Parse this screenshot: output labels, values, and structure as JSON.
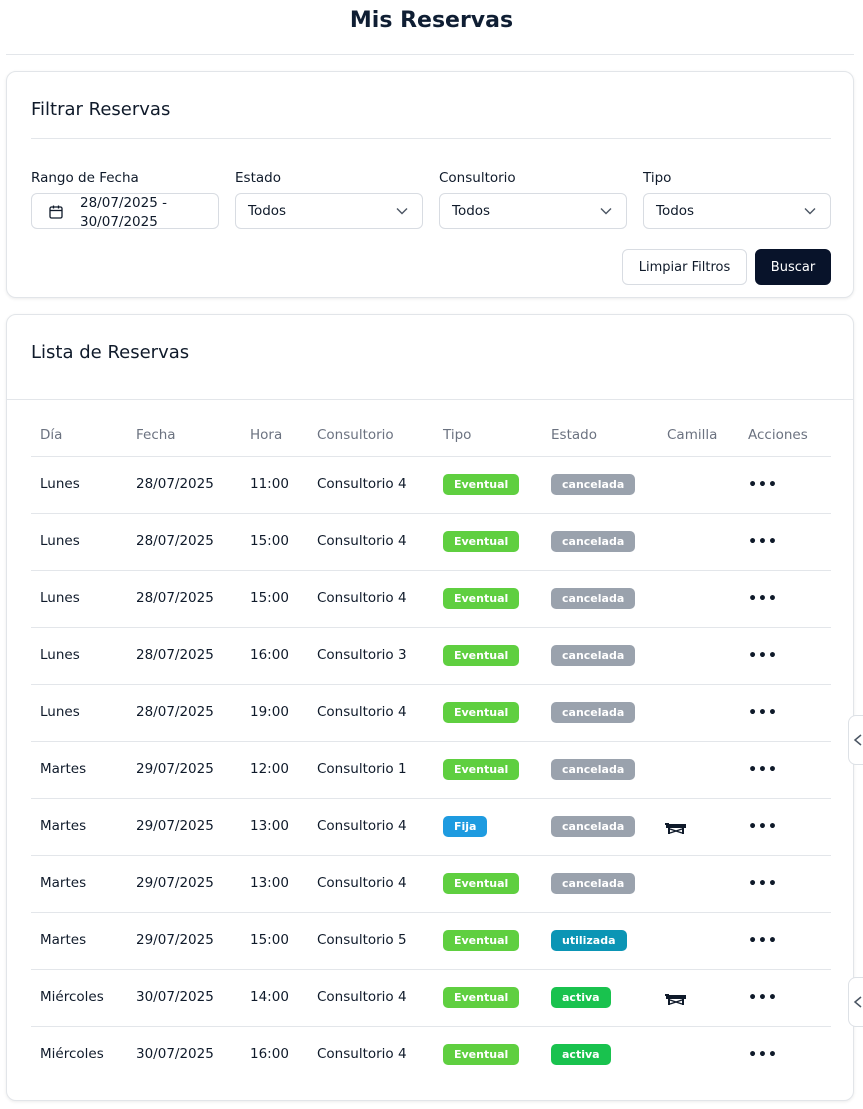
{
  "page": {
    "title": "Mis Reservas"
  },
  "filters": {
    "title": "Filtrar Reservas",
    "date_range": {
      "label": "Rango de Fecha",
      "value": "28/07/2025 - 30/07/2025"
    },
    "estado": {
      "label": "Estado",
      "value": "Todos"
    },
    "consultorio": {
      "label": "Consultorio",
      "value": "Todos"
    },
    "tipo": {
      "label": "Tipo",
      "value": "Todos"
    },
    "clear_label": "Limpiar Filtros",
    "search_label": "Buscar"
  },
  "list": {
    "title": "Lista de Reservas",
    "columns": [
      "Día",
      "Fecha",
      "Hora",
      "Consultorio",
      "Tipo",
      "Estado",
      "Camilla",
      "Acciones"
    ],
    "actions_glyph": "•••",
    "rows": [
      {
        "dia": "Lunes",
        "fecha": "28/07/2025",
        "hora": "11:00",
        "consultorio": "Consultorio 4",
        "tipo": "Eventual",
        "estado": "cancelada",
        "camilla": false
      },
      {
        "dia": "Lunes",
        "fecha": "28/07/2025",
        "hora": "15:00",
        "consultorio": "Consultorio 4",
        "tipo": "Eventual",
        "estado": "cancelada",
        "camilla": false
      },
      {
        "dia": "Lunes",
        "fecha": "28/07/2025",
        "hora": "15:00",
        "consultorio": "Consultorio 4",
        "tipo": "Eventual",
        "estado": "cancelada",
        "camilla": false
      },
      {
        "dia": "Lunes",
        "fecha": "28/07/2025",
        "hora": "16:00",
        "consultorio": "Consultorio 3",
        "tipo": "Eventual",
        "estado": "cancelada",
        "camilla": false
      },
      {
        "dia": "Lunes",
        "fecha": "28/07/2025",
        "hora": "19:00",
        "consultorio": "Consultorio 4",
        "tipo": "Eventual",
        "estado": "cancelada",
        "camilla": false
      },
      {
        "dia": "Martes",
        "fecha": "29/07/2025",
        "hora": "12:00",
        "consultorio": "Consultorio 1",
        "tipo": "Eventual",
        "estado": "cancelada",
        "camilla": false
      },
      {
        "dia": "Martes",
        "fecha": "29/07/2025",
        "hora": "13:00",
        "consultorio": "Consultorio 4",
        "tipo": "Fija",
        "estado": "cancelada",
        "camilla": true
      },
      {
        "dia": "Martes",
        "fecha": "29/07/2025",
        "hora": "13:00",
        "consultorio": "Consultorio 4",
        "tipo": "Eventual",
        "estado": "cancelada",
        "camilla": false
      },
      {
        "dia": "Martes",
        "fecha": "29/07/2025",
        "hora": "15:00",
        "consultorio": "Consultorio 5",
        "tipo": "Eventual",
        "estado": "utilizada",
        "camilla": false
      },
      {
        "dia": "Miércoles",
        "fecha": "30/07/2025",
        "hora": "14:00",
        "consultorio": "Consultorio 4",
        "tipo": "Eventual",
        "estado": "activa",
        "camilla": true
      },
      {
        "dia": "Miércoles",
        "fecha": "30/07/2025",
        "hora": "16:00",
        "consultorio": "Consultorio 4",
        "tipo": "Eventual",
        "estado": "activa",
        "camilla": false
      }
    ]
  },
  "colors": {
    "eventual": "#5fcf40",
    "fija": "#1e9be0",
    "cancelada": "#9aa2ad",
    "utilizada": "#0b95b5",
    "activa": "#19c24e",
    "primary_button": "#08132a"
  },
  "icons": {
    "date": "calendar-icon",
    "select": "chevron-down-icon",
    "camilla": "massage-table-icon",
    "actions": "more-horizontal-icon"
  }
}
